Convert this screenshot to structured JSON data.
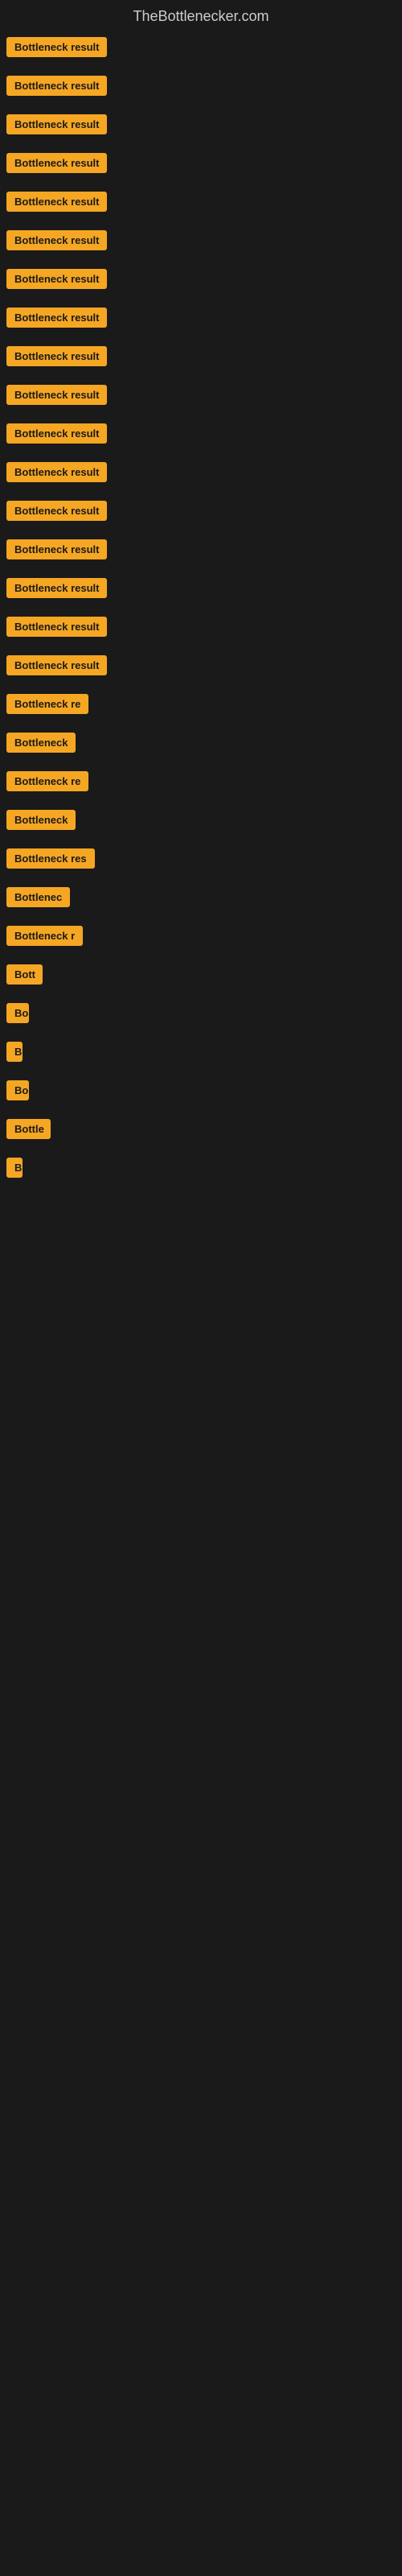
{
  "site": {
    "title": "TheBottlenecker.com"
  },
  "items": [
    {
      "label": "Bottleneck result",
      "width": 155
    },
    {
      "label": "Bottleneck result",
      "width": 155
    },
    {
      "label": "Bottleneck result",
      "width": 155
    },
    {
      "label": "Bottleneck result",
      "width": 155
    },
    {
      "label": "Bottleneck result",
      "width": 155
    },
    {
      "label": "Bottleneck result",
      "width": 155
    },
    {
      "label": "Bottleneck result",
      "width": 155
    },
    {
      "label": "Bottleneck result",
      "width": 155
    },
    {
      "label": "Bottleneck result",
      "width": 155
    },
    {
      "label": "Bottleneck result",
      "width": 155
    },
    {
      "label": "Bottleneck result",
      "width": 155
    },
    {
      "label": "Bottleneck result",
      "width": 155
    },
    {
      "label": "Bottleneck result",
      "width": 155
    },
    {
      "label": "Bottleneck result",
      "width": 155
    },
    {
      "label": "Bottleneck result",
      "width": 155
    },
    {
      "label": "Bottleneck result",
      "width": 140
    },
    {
      "label": "Bottleneck result",
      "width": 155
    },
    {
      "label": "Bottleneck re",
      "width": 120
    },
    {
      "label": "Bottleneck",
      "width": 90
    },
    {
      "label": "Bottleneck re",
      "width": 120
    },
    {
      "label": "Bottleneck",
      "width": 90
    },
    {
      "label": "Bottleneck res",
      "width": 130
    },
    {
      "label": "Bottlenec",
      "width": 82
    },
    {
      "label": "Bottleneck r",
      "width": 110
    },
    {
      "label": "Bott",
      "width": 45
    },
    {
      "label": "Bo",
      "width": 28
    },
    {
      "label": "B",
      "width": 14
    },
    {
      "label": "Bo",
      "width": 28
    },
    {
      "label": "Bottle",
      "width": 55
    },
    {
      "label": "B",
      "width": 12
    }
  ]
}
